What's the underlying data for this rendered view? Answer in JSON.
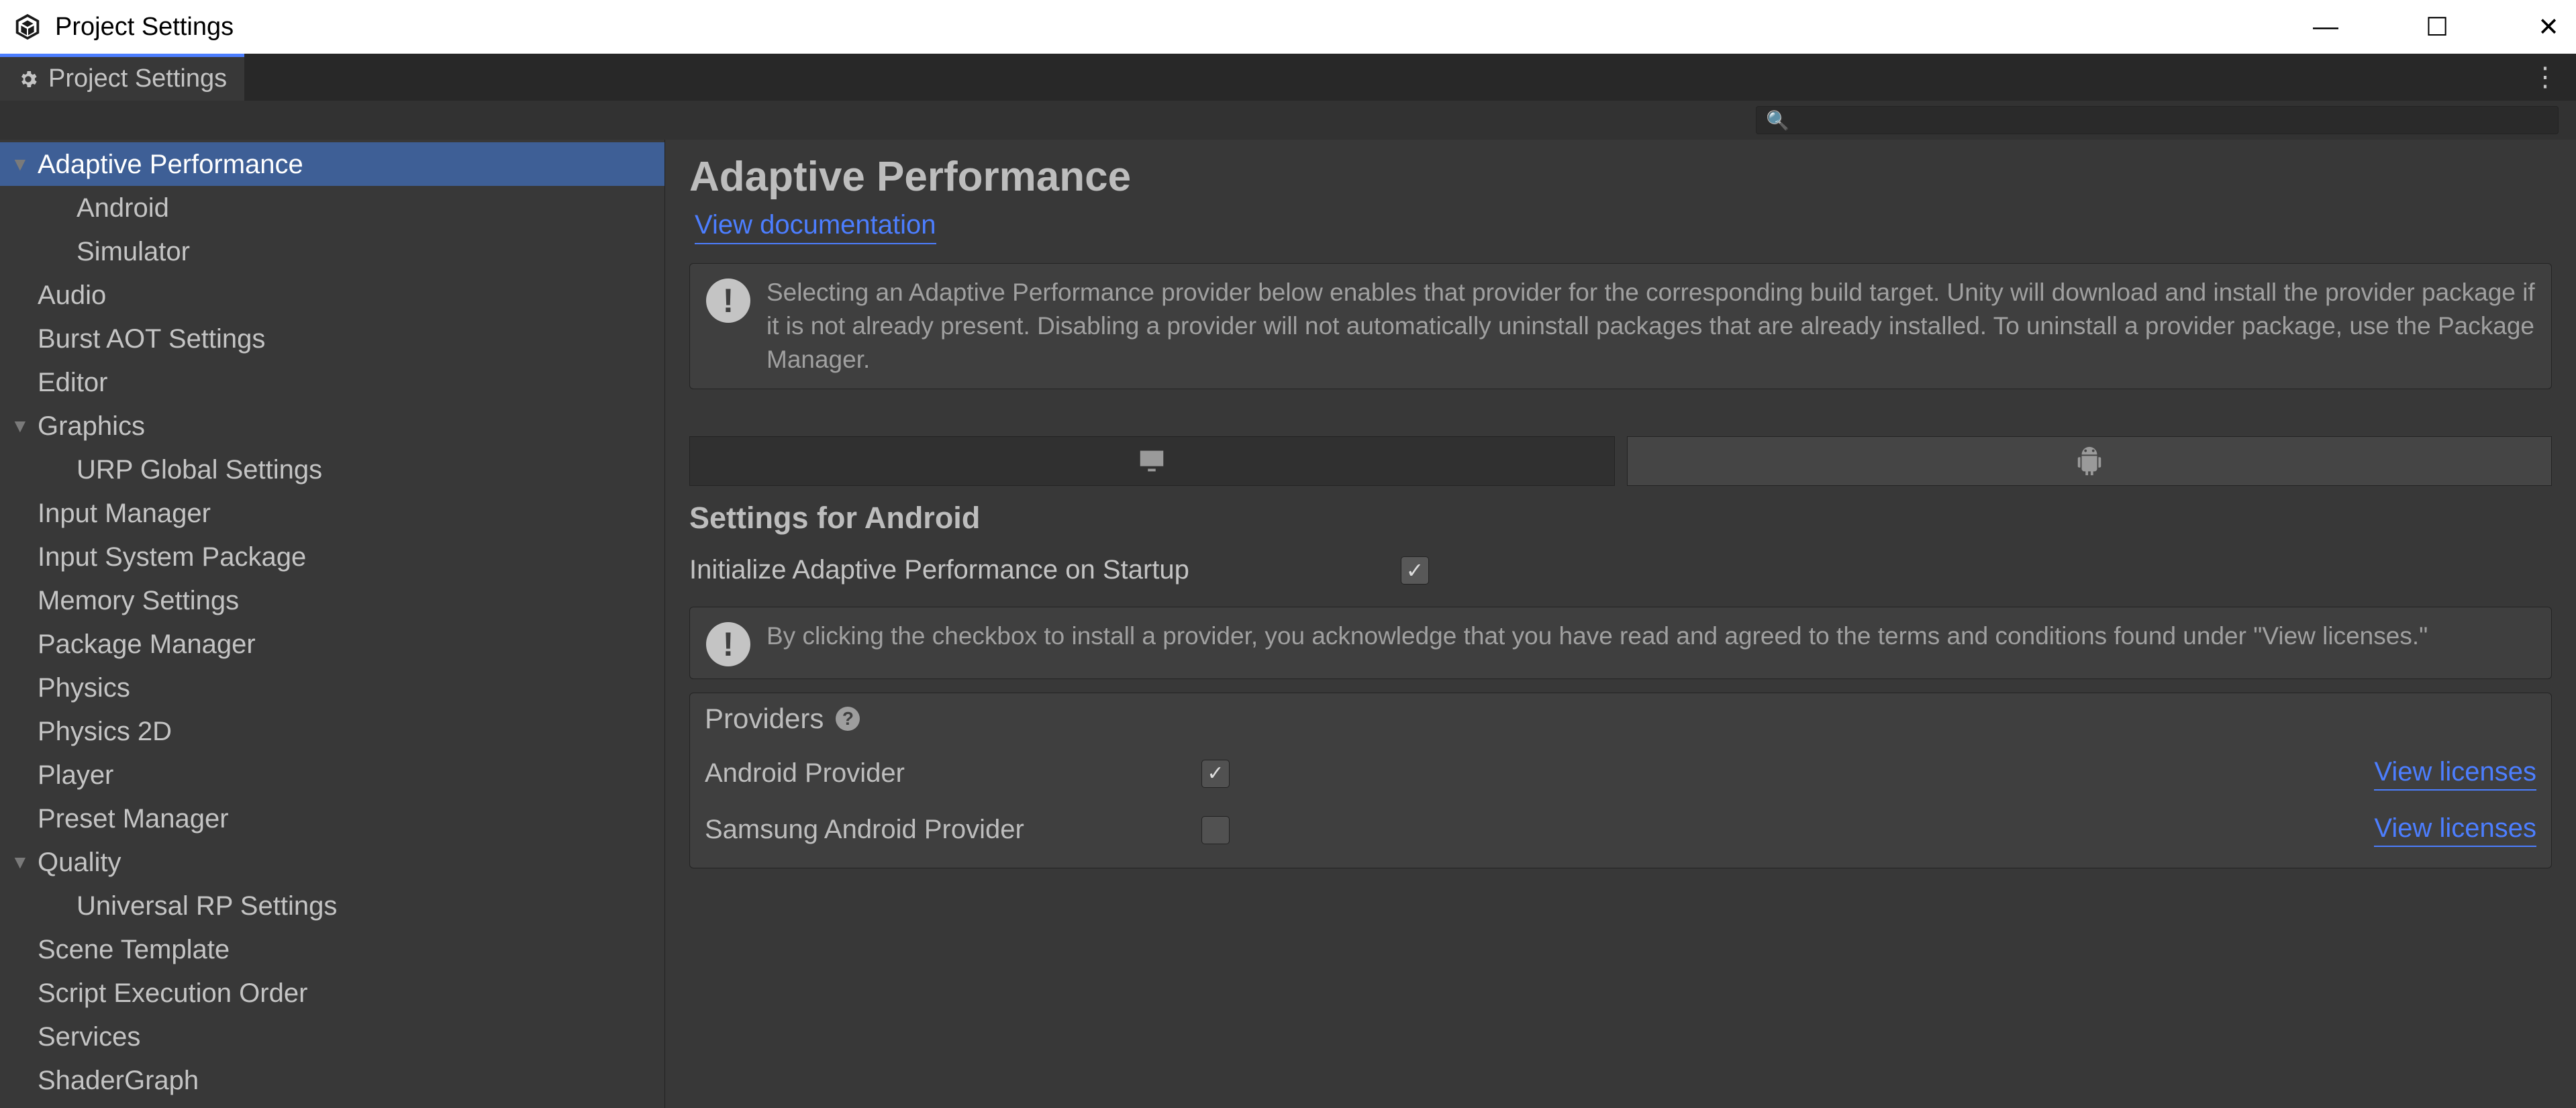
{
  "window": {
    "title": "Project Settings"
  },
  "tab": {
    "label": "Project Settings"
  },
  "sidebar": {
    "items": [
      {
        "label": "Adaptive Performance",
        "depth": 0,
        "arrow": true,
        "selected": true
      },
      {
        "label": "Android",
        "depth": 1
      },
      {
        "label": "Simulator",
        "depth": 1
      },
      {
        "label": "Audio",
        "depth": 0
      },
      {
        "label": "Burst AOT Settings",
        "depth": 0
      },
      {
        "label": "Editor",
        "depth": 0
      },
      {
        "label": "Graphics",
        "depth": 0,
        "arrow": true
      },
      {
        "label": "URP Global Settings",
        "depth": 1
      },
      {
        "label": "Input Manager",
        "depth": 0
      },
      {
        "label": "Input System Package",
        "depth": 0
      },
      {
        "label": "Memory Settings",
        "depth": 0
      },
      {
        "label": "Package Manager",
        "depth": 0
      },
      {
        "label": "Physics",
        "depth": 0
      },
      {
        "label": "Physics 2D",
        "depth": 0
      },
      {
        "label": "Player",
        "depth": 0
      },
      {
        "label": "Preset Manager",
        "depth": 0
      },
      {
        "label": "Quality",
        "depth": 0,
        "arrow": true
      },
      {
        "label": "Universal RP Settings",
        "depth": 1
      },
      {
        "label": "Scene Template",
        "depth": 0
      },
      {
        "label": "Script Execution Order",
        "depth": 0
      },
      {
        "label": "Services",
        "depth": 0
      },
      {
        "label": "ShaderGraph",
        "depth": 0
      }
    ]
  },
  "content": {
    "heading": "Adaptive Performance",
    "doc_link": "View documentation",
    "info1": "Selecting an Adaptive Performance provider below enables that provider for the corresponding build target. Unity will download and install the provider package if it is not already present. Disabling a provider will not automatically uninstall packages that are already installed. To uninstall a provider package, use the Package Manager.",
    "section_title": "Settings for Android",
    "init_label": "Initialize Adaptive Performance on Startup",
    "init_checked": true,
    "info2": "By clicking the checkbox to install a provider, you acknowledge that you have read and agreed to the terms and conditions found under \"View licenses.\"",
    "providers_title": "Providers",
    "providers": [
      {
        "name": "Android Provider",
        "checked": true,
        "link": "View licenses"
      },
      {
        "name": "Samsung Android Provider",
        "checked": false,
        "link": "View licenses"
      }
    ]
  }
}
